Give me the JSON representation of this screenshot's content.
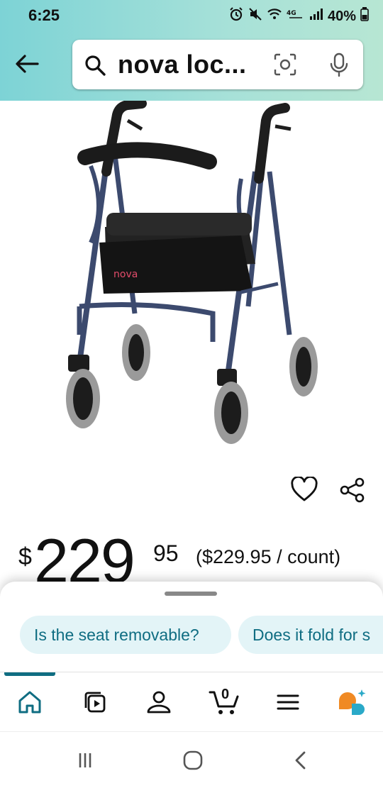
{
  "status_bar": {
    "time": "6:25",
    "battery": "40%"
  },
  "search": {
    "query": "nova loc..."
  },
  "product": {
    "image_alt": "Nova rollator walker",
    "brand_mark": "nova"
  },
  "price": {
    "dollar_sign": "$",
    "whole": "229",
    "cents": "95",
    "per_unit": "($229.95 / count)"
  },
  "suggestions": [
    {
      "label": "Is the seat removable?"
    },
    {
      "label": "Does it fold for s"
    }
  ],
  "tabbar": {
    "cart_count": "0",
    "active_tab": "home"
  },
  "icons": [
    "back-arrow-icon",
    "search-icon",
    "camera-icon",
    "mic-icon",
    "heart-icon",
    "share-icon",
    "home-icon",
    "video-icon",
    "account-icon",
    "cart-icon",
    "menu-icon",
    "rufus-icon"
  ],
  "colors": {
    "accent": "#0f6d82",
    "header_gradient_start": "#7dd3d6",
    "chip_bg": "#e3f4f7"
  }
}
